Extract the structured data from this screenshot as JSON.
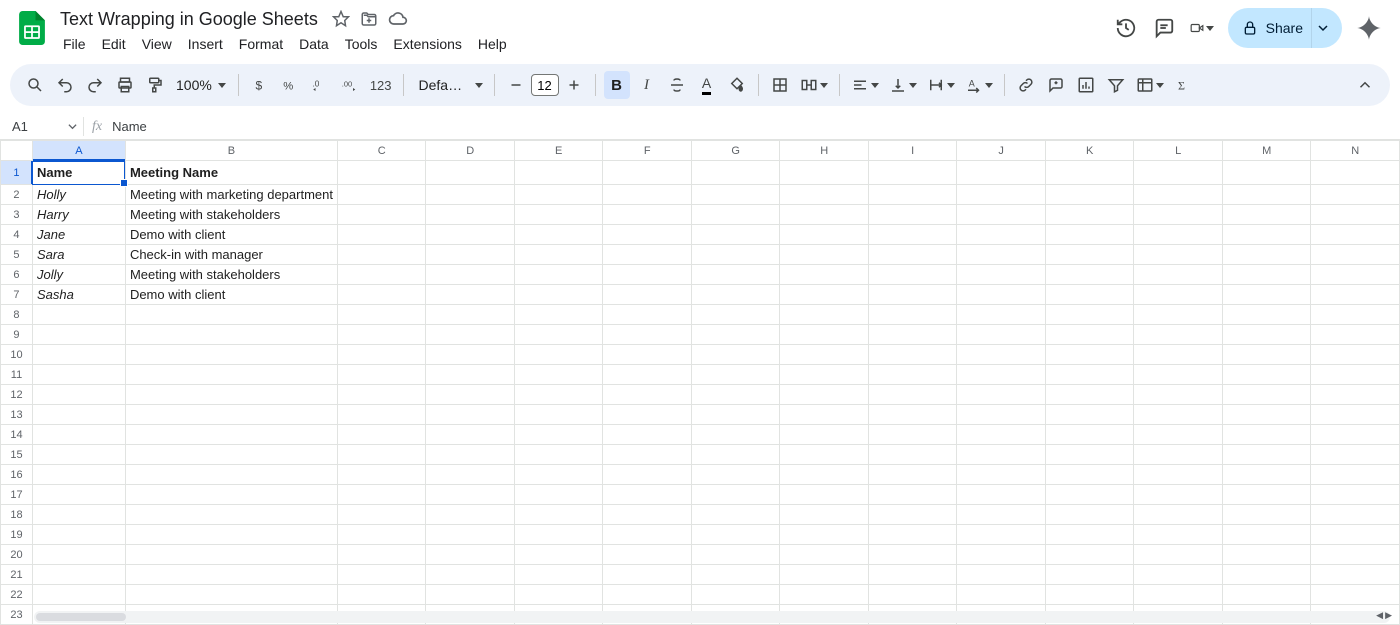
{
  "doc": {
    "title": "Text Wrapping in Google Sheets"
  },
  "menu": [
    "File",
    "Edit",
    "View",
    "Insert",
    "Format",
    "Data",
    "Tools",
    "Extensions",
    "Help"
  ],
  "share": {
    "label": "Share"
  },
  "toolbar": {
    "zoom": "100%",
    "font": "Defaul…",
    "font_size": "12"
  },
  "namebox": "A1",
  "formula_value": "Name",
  "columns": [
    "A",
    "B",
    "C",
    "D",
    "E",
    "F",
    "G",
    "H",
    "I",
    "J",
    "K",
    "L",
    "M",
    "N"
  ],
  "header_row": {
    "A": "Name",
    "B": "Meeting Name"
  },
  "rows": [
    {
      "A": "Holly",
      "B": "Meeting with marketing department"
    },
    {
      "A": "Harry",
      "B": "Meeting with stakeholders"
    },
    {
      "A": "Jane",
      "B": "Demo with client"
    },
    {
      "A": "Sara",
      "B": "Check-in with manager"
    },
    {
      "A": "Jolly",
      "B": "Meeting with stakeholders"
    },
    {
      "A": "Sasha",
      "B": "Demo with client"
    }
  ],
  "total_rows": 23
}
